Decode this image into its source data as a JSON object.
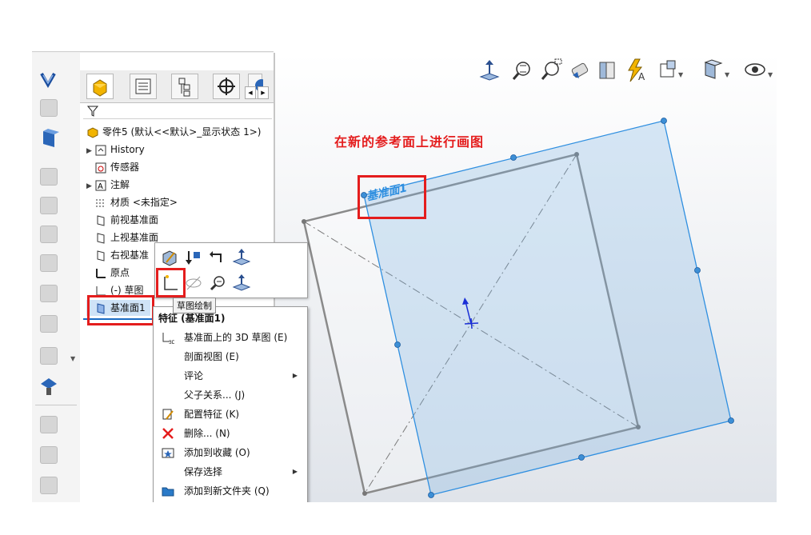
{
  "feature_tree": {
    "root": "零件5 (默认<<默认>_显示状态 1>)",
    "items": [
      {
        "label": "History",
        "expandable": true
      },
      {
        "label": "传感器",
        "expandable": false
      },
      {
        "label": "注解",
        "expandable": true
      },
      {
        "label": "材质 <未指定>",
        "expandable": false
      },
      {
        "label": "前视基准面",
        "expandable": false
      },
      {
        "label": "上视基准面",
        "expandable": false
      },
      {
        "label": "右视基准",
        "expandable": false
      },
      {
        "label": "原点",
        "expandable": false
      },
      {
        "label": "(-) 草图",
        "expandable": false
      },
      {
        "label": "基准面1",
        "expandable": false,
        "selected": true
      }
    ]
  },
  "tooltip": "草图绘制",
  "context_menu": {
    "header": "特征 (基准面1)",
    "items": [
      {
        "label": "基准面上的 3D 草图 (E)",
        "icon": "3d-sketch-icon",
        "submenu": false
      },
      {
        "label": "剖面视图 (E)",
        "icon": "",
        "submenu": false
      },
      {
        "label": "评论",
        "icon": "",
        "submenu": true
      },
      {
        "label": "父子关系... (J)",
        "icon": "",
        "submenu": false
      },
      {
        "label": "配置特征 (K)",
        "icon": "configure-icon",
        "submenu": false
      },
      {
        "label": "删除... (N)",
        "icon": "delete-icon",
        "submenu": false
      },
      {
        "label": "添加到收藏 (O)",
        "icon": "favorite-icon",
        "submenu": false
      },
      {
        "label": "保存选择",
        "icon": "",
        "submenu": true
      },
      {
        "label": "添加到新文件夹 (Q)",
        "icon": "folder-icon",
        "submenu": false
      }
    ]
  },
  "annotation": "在新的参考面上进行画图",
  "plane_label": "基准面1",
  "colors": {
    "annotation_red": "#e41d1d",
    "plane_blue": "#2f8fe0",
    "plane_fill": "#cfe4f6"
  }
}
